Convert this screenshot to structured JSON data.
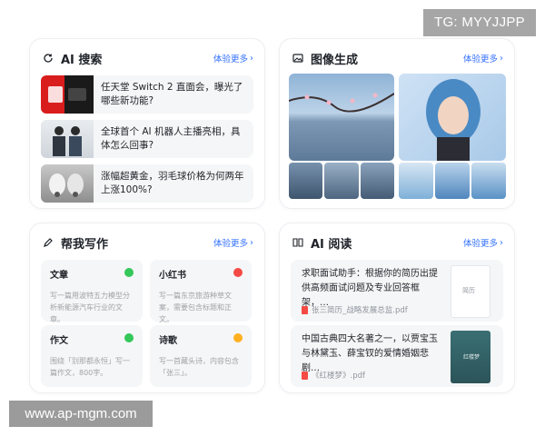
{
  "watermarks": {
    "top_right": "TG: MYYJJPP",
    "bottom_left": "www.ap-mgm.com"
  },
  "more_label": "体验更多",
  "search": {
    "title": "AI 搜索",
    "items": [
      {
        "text": "任天堂 Switch 2 直面会，曝光了哪些新功能?"
      },
      {
        "text": "全球首个 AI 机器人主播亮相，具体怎么回事?"
      },
      {
        "text": "涨幅超黄金，羽毛球价格为何两年上涨100%?"
      }
    ]
  },
  "image": {
    "title": "图像生成"
  },
  "write": {
    "title": "帮我写作",
    "tiles": [
      {
        "title": "文章",
        "desc": "写一篇用波特五力模型分析新能源汽车行业的文章。",
        "color": "#34c759"
      },
      {
        "title": "小红书",
        "desc": "写一篇东京旅游种草文案，需要包含标题和正文。",
        "color": "#f54a45"
      },
      {
        "title": "作文",
        "desc": "围绕「别那都永恒」写一篇作文，800字。",
        "color": "#34c759"
      },
      {
        "title": "诗歌",
        "desc": "写一首藏头诗，内容包含「张三」。",
        "color": "#ffb020"
      }
    ]
  },
  "read": {
    "title": "AI 阅读",
    "docs": [
      {
        "text": "求职面试助手：根据你的简历出提供高频面试问题及专业回答框架，…",
        "file": "张三简历_战略发展总监.pdf",
        "cover": "简历"
      },
      {
        "text": "中国古典四大名著之一，以贾宝玉与林黛玉、薛宝钗的爱情婚姻悲剧…",
        "file": "《红楼梦》.pdf",
        "cover": "红楼梦"
      }
    ]
  }
}
